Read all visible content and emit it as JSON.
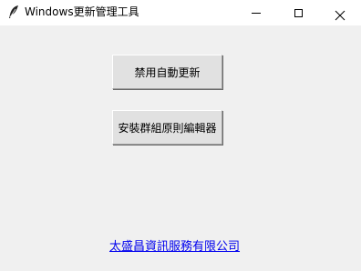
{
  "window": {
    "title": "Windows更新管理工具",
    "app_icon": "feather-icon",
    "controls": {
      "minimize": "minimize-icon",
      "maximize": "maximize-icon",
      "close": "close-icon"
    }
  },
  "buttons": {
    "disable_update_label": "禁用自動更新",
    "install_gpedit_label": "安裝群組原則編輯器"
  },
  "footer": {
    "company_link": "太盛昌資訊服務有限公司"
  },
  "colors": {
    "background": "#f0f0f0",
    "titlebar": "#ffffff",
    "button_face": "#e1e1e1",
    "link": "#0000ee"
  }
}
